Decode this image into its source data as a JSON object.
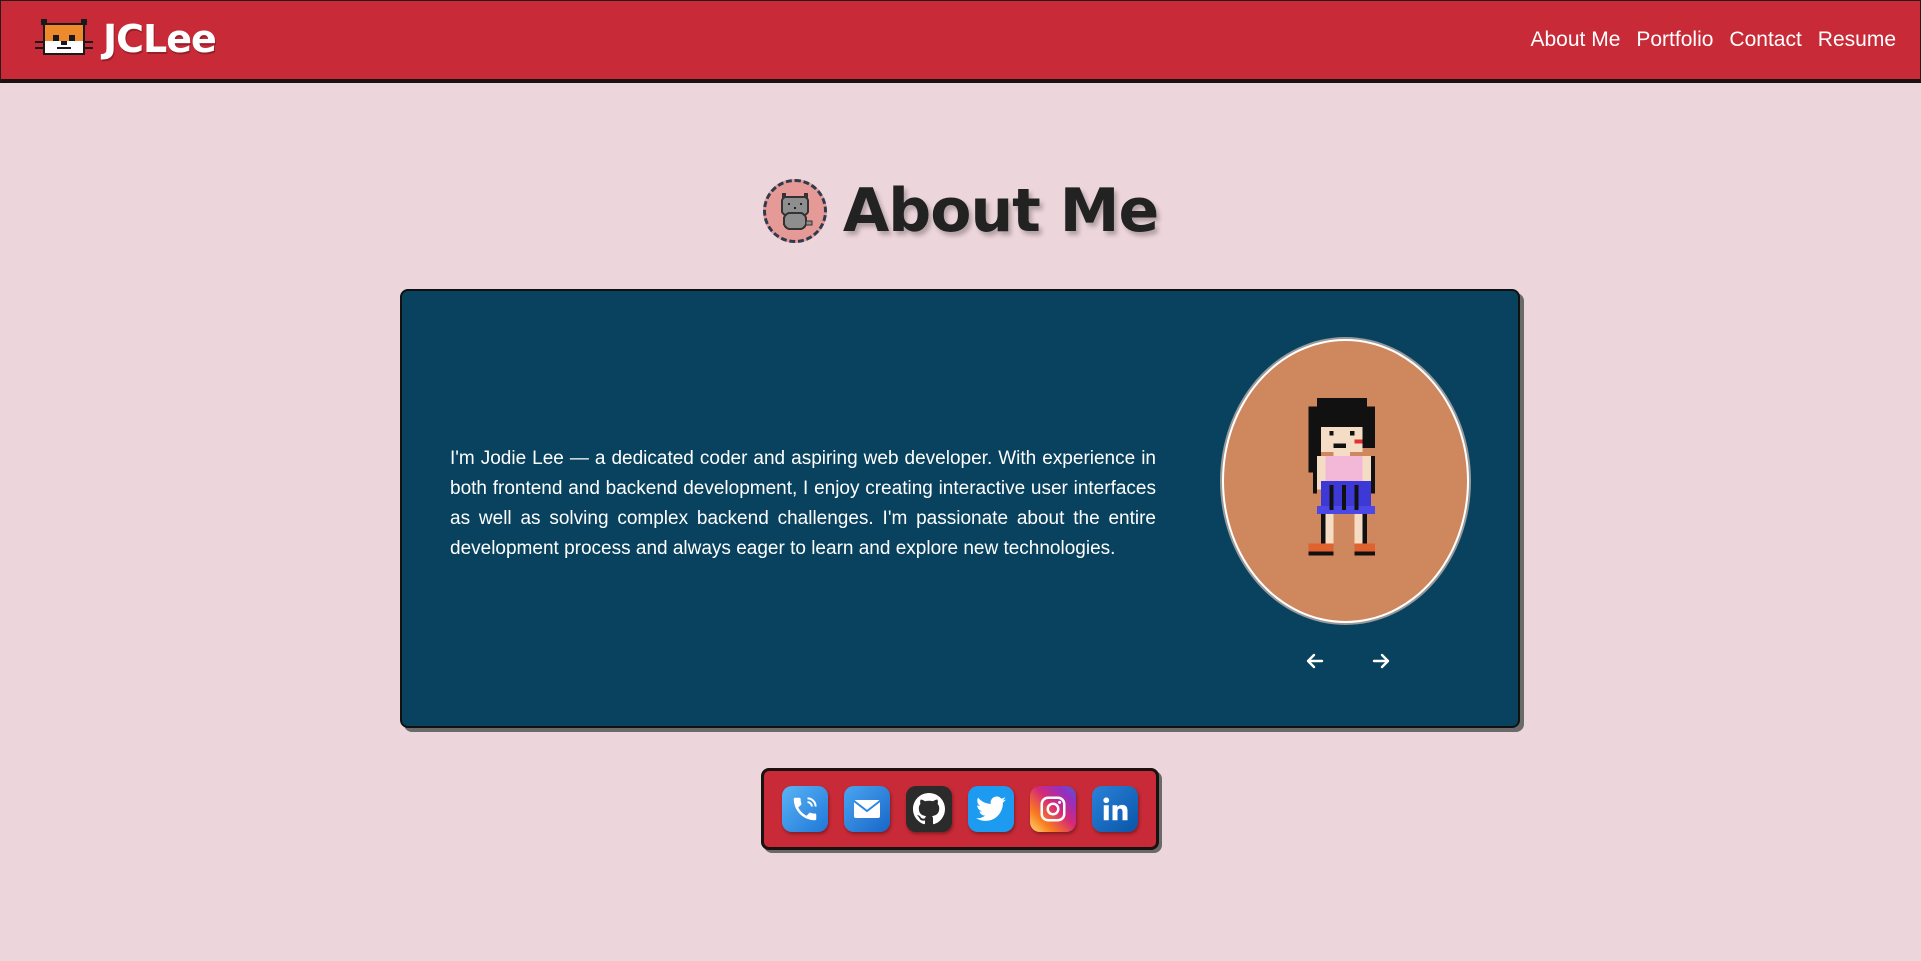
{
  "brand": {
    "name": "JCLee",
    "logo_icon": "pixel-cat-icon"
  },
  "nav": {
    "links": [
      {
        "label": "About Me"
      },
      {
        "label": "Portfolio"
      },
      {
        "label": "Contact"
      },
      {
        "label": "Resume"
      }
    ]
  },
  "page": {
    "title": "About Me",
    "title_icon": "cat-avatar-icon"
  },
  "about": {
    "bio": "I'm Jodie Lee — a dedicated coder and aspiring web developer. With experience in both frontend and backend development, I enjoy creating interactive user interfaces as well as solving complex backend challenges. I'm passionate about the entire development process and always eager to learn and explore new technologies.",
    "portrait_icon": "pixel-girl-avatar",
    "prev_icon": "arrow-left-icon",
    "next_icon": "arrow-right-icon"
  },
  "social": [
    {
      "icon": "phone-icon",
      "color": "#3a97e8"
    },
    {
      "icon": "mail-icon",
      "color": "#2d86e0"
    },
    {
      "icon": "github-icon",
      "color": "#2b2b2b"
    },
    {
      "icon": "twitter-icon",
      "color": "#1d9bf0"
    },
    {
      "icon": "instagram-icon",
      "color": "#d62976"
    },
    {
      "icon": "linkedin-icon",
      "color": "#0a66c2"
    }
  ],
  "colors": {
    "nav_bg": "#c92a37",
    "page_bg": "#ecd5db",
    "card_bg": "#08425e",
    "portrait_bg": "#cf875e"
  }
}
